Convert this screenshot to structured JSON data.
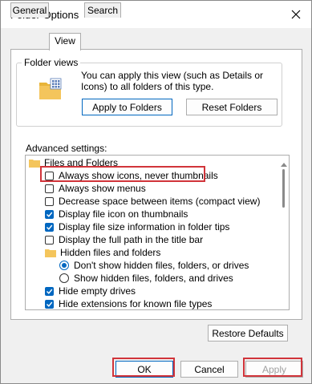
{
  "window": {
    "title": "Folder Options"
  },
  "tabs": [
    {
      "label": "General",
      "active": false
    },
    {
      "label": "View",
      "active": true
    },
    {
      "label": "Search",
      "active": false
    }
  ],
  "folder_views": {
    "label": "Folder views",
    "description": "You can apply this view (such as Details or Icons) to all folders of this type.",
    "apply_label": "Apply to Folders",
    "reset_label": "Reset Folders"
  },
  "advanced": {
    "label": "Advanced settings:",
    "items": [
      {
        "type": "folder",
        "label": "Files and Folders"
      },
      {
        "type": "checkbox",
        "label": "Always show icons, never thumbnails",
        "checked": false
      },
      {
        "type": "checkbox",
        "label": "Always show menus",
        "checked": false
      },
      {
        "type": "checkbox",
        "label": "Decrease space between items (compact view)",
        "checked": false
      },
      {
        "type": "checkbox",
        "label": "Display file icon on thumbnails",
        "checked": true
      },
      {
        "type": "checkbox",
        "label": "Display file size information in folder tips",
        "checked": true
      },
      {
        "type": "checkbox",
        "label": "Display the full path in the title bar",
        "checked": false
      },
      {
        "type": "folder",
        "label": "Hidden files and folders"
      },
      {
        "type": "radio",
        "label": "Don't show hidden files, folders, or drives",
        "checked": true
      },
      {
        "type": "radio",
        "label": "Show hidden files, folders, and drives",
        "checked": false
      },
      {
        "type": "checkbox",
        "label": "Hide empty drives",
        "checked": true
      },
      {
        "type": "checkbox",
        "label": "Hide extensions for known file types",
        "checked": true
      }
    ]
  },
  "buttons": {
    "restore": "Restore Defaults",
    "ok": "OK",
    "cancel": "Cancel",
    "apply": "Apply"
  },
  "colors": {
    "accent": "#0067c0",
    "highlight": "#d1343a",
    "folder": "#f4c55c"
  }
}
